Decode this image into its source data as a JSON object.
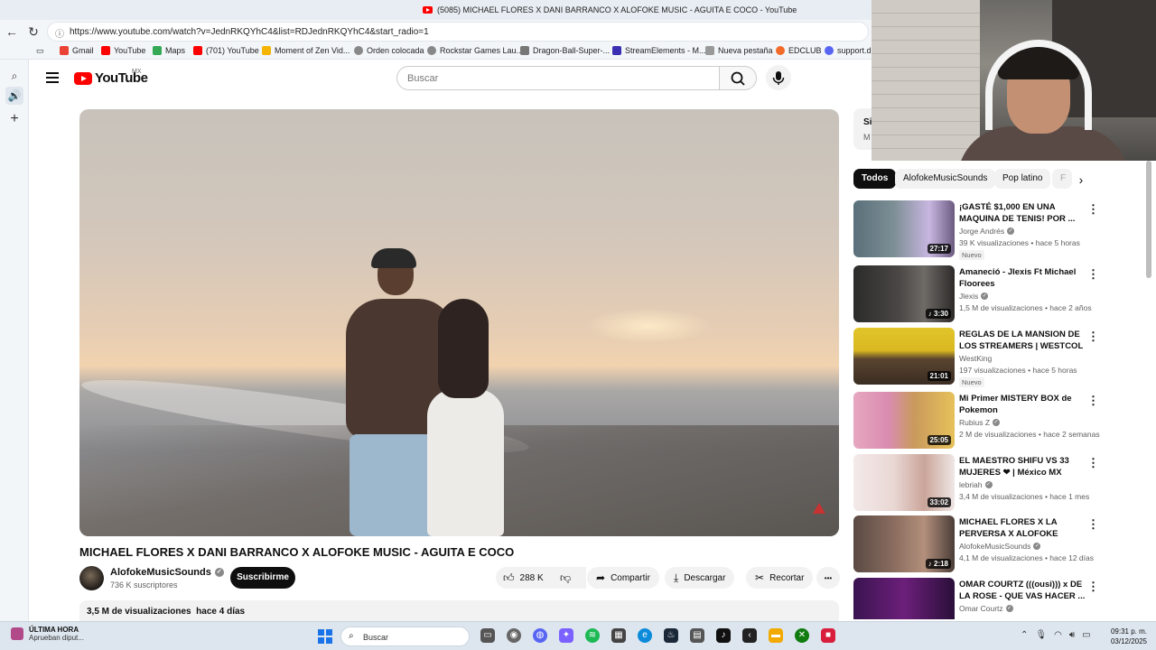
{
  "browser": {
    "tab_title": "(5085) MICHAEL FLORES X DANI BARRANCO X ALOFOKE MUSIC - AGUITA E COCO - YouTube",
    "url": "https://www.youtube.com/watch?v=JednRKQYhC4&list=RDJednRKQYhC4&start_radio=1",
    "bookmarks": [
      "Gmail",
      "YouTube",
      "Maps",
      "(701) YouTube",
      "Moment of Zen Vid...",
      "Orden colocada",
      "Rockstar Games Lau...",
      "Dragon-Ball-Super-...",
      "StreamElements - M...",
      "Nueva pestaña",
      "EDCLUB",
      "support.di"
    ]
  },
  "header": {
    "logo_text": "YouTube",
    "country_code": "MX",
    "search_placeholder": "Buscar"
  },
  "video": {
    "title": "MICHAEL FLORES X DANI BARRANCO X ALOFOKE MUSIC - AGUITA E COCO",
    "channel": "AlofokeMusicSounds",
    "subscribers": "736 K suscriptores",
    "subscribe_label": "Suscribirme",
    "likes": "288 K",
    "share_label": "Compartir",
    "download_label": "Descargar",
    "clip_label": "Recortar",
    "more_label": "•••",
    "views": "3,5 M de visualizaciones",
    "age": "hace 4 días"
  },
  "playlist": {
    "line1": "Si",
    "line2": "M"
  },
  "chips": [
    "Todos",
    "AlofokeMusicSounds",
    "Pop latino",
    "F"
  ],
  "recommendations": [
    {
      "title": "¡GASTÉ $1,000 EN UNA MAQUINA DE TENIS! POR ...",
      "channel": "Jorge Andrés",
      "meta": "39 K visualizaciones • hace 5 horas",
      "badge": "Nuevo",
      "duration": "27:17"
    },
    {
      "title": "Amaneció - Jlexis Ft Michael Floorees",
      "channel": "Jlexis",
      "meta": "1,5 M de visualizaciones • hace 2 años",
      "badge": "",
      "duration": "♪ 3:30"
    },
    {
      "title": "REGLAS DE LA MANSION DE LOS STREAMERS | WESTCOL",
      "channel": "WestKing",
      "meta": "197 visualizaciones • hace 5 horas",
      "badge": "Nuevo",
      "duration": "21:01"
    },
    {
      "title": "Mi Primer MISTERY BOX de Pokemon",
      "channel": "Rubius Z",
      "meta": "2 M de visualizaciones • hace 2 semanas",
      "badge": "",
      "duration": "25:05"
    },
    {
      "title": "EL MAESTRO SHIFU VS 33 MUJERES ❤ | México MX",
      "channel": "lebriah",
      "meta": "3,4 M de visualizaciones • hace 1 mes",
      "badge": "",
      "duration": "33:02"
    },
    {
      "title": "MICHAEL FLORES X LA PERVERSA X ALOFOKE MUSIC...",
      "channel": "AlofokeMusicSounds",
      "meta": "4,1 M de visualizaciones • hace 12 días",
      "badge": "",
      "duration": "♪ 2:18"
    },
    {
      "title": "OMAR COURTZ (((ousi))) x DE LA ROSE - QUE VAS HACER ...",
      "channel": "Omar Courtz",
      "meta": "",
      "badge": "",
      "duration": ""
    }
  ],
  "taskbar": {
    "news_title": "ÚLTIMA HORA",
    "news_sub": "Aprueban diput...",
    "search_text": "Buscar",
    "time": "09:31 p. m.",
    "date": "03/12/2025"
  }
}
